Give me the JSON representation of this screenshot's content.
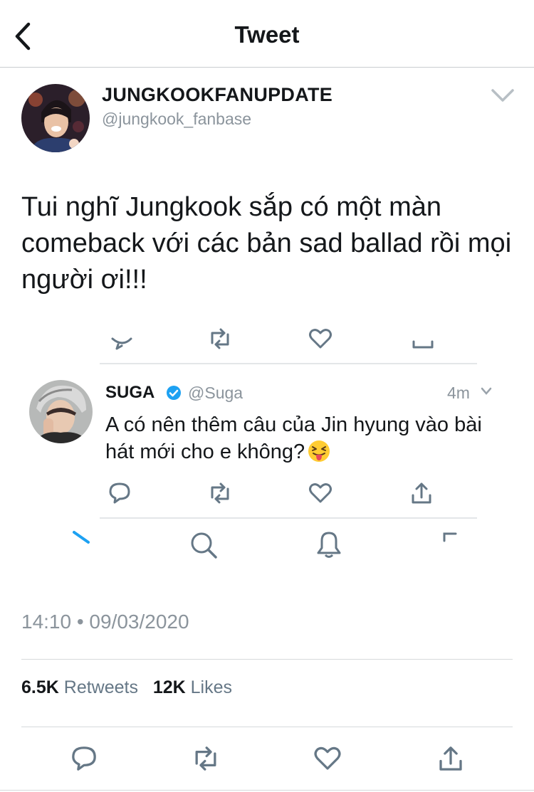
{
  "header": {
    "title": "Tweet"
  },
  "author": {
    "display_name": "JUNGKOOKFANUPDATE",
    "handle": "@jungkook_fanbase"
  },
  "tweet": {
    "text": "Tui nghĩ Jungkook sắp có một màn comeback với các bản sad ballad rồi mọi người ơi!!!"
  },
  "embedded": {
    "name": "SUGA",
    "handle": "@Suga",
    "time": "4m",
    "text": "A có nên thêm câu của Jin hyung vào bài hát mới cho e không?",
    "icons": [
      "reply-icon",
      "retweet-icon",
      "like-icon",
      "share-icon",
      "compose-icon",
      "search-icon",
      "notifications-icon",
      "messages-icon"
    ]
  },
  "meta": {
    "timestamp": "14:10 • 09/03/2020",
    "retweets_count": "6.5K",
    "retweets_label": "Retweets",
    "likes_count": "12K",
    "likes_label": "Likes"
  },
  "colors": {
    "text": "#14171a",
    "secondary": "#8b949c",
    "icon": "#657786",
    "blue": "#1da1f2"
  }
}
